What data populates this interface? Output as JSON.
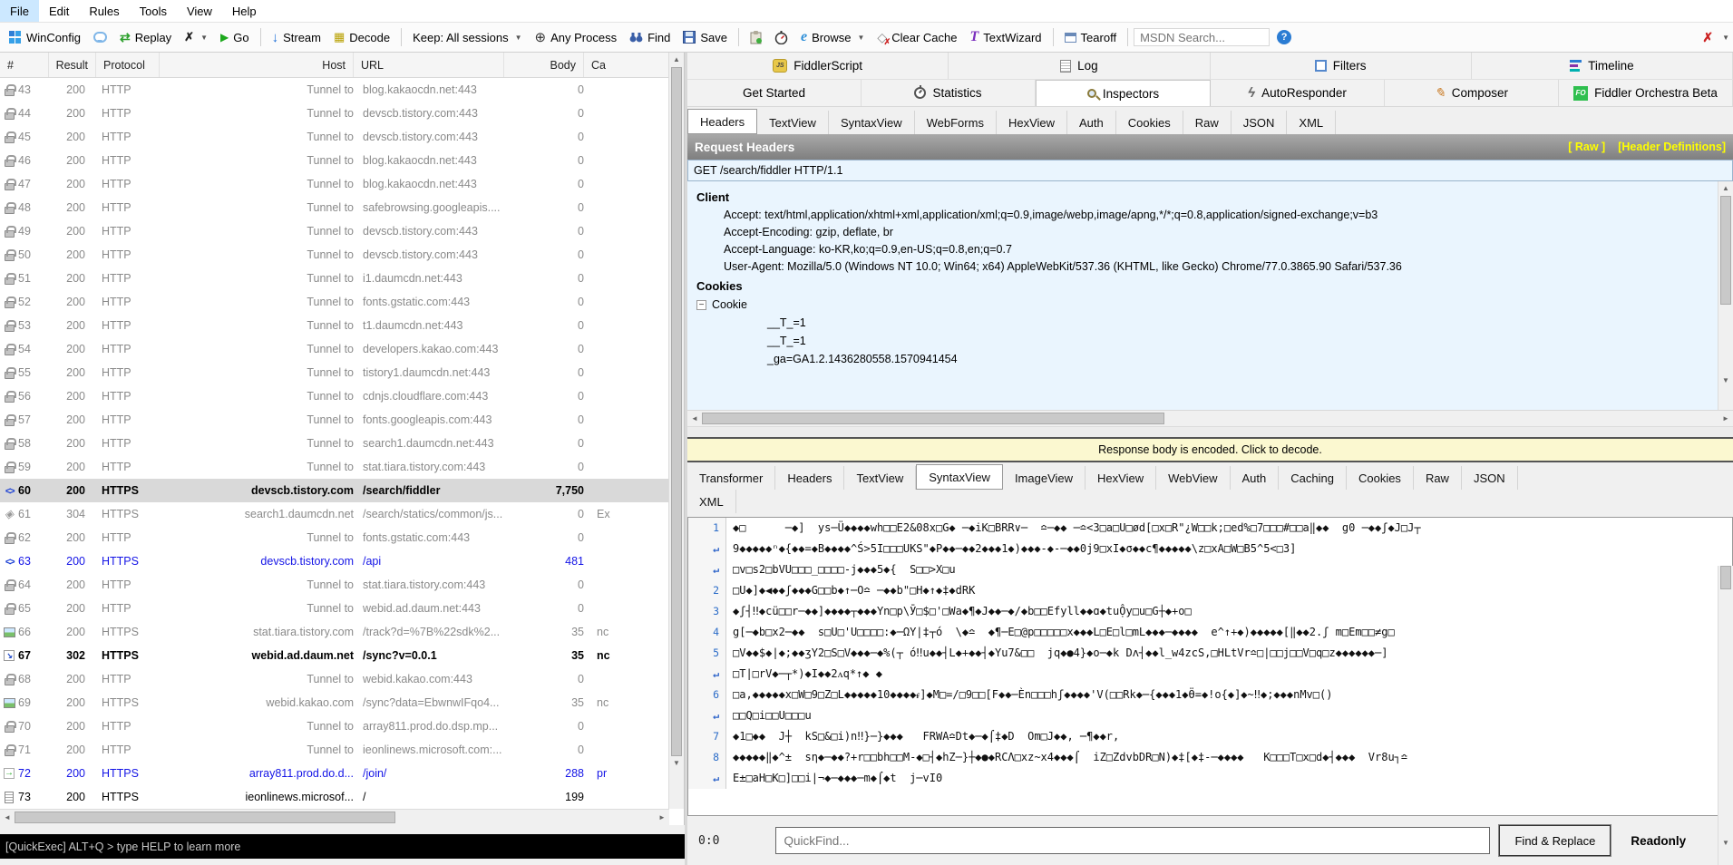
{
  "menu": {
    "items": [
      {
        "label": "File",
        "cls": "active"
      },
      {
        "label": "Edit",
        "cls": ""
      },
      {
        "label": "Rules",
        "cls": ""
      },
      {
        "label": "Tools",
        "cls": ""
      },
      {
        "label": "View",
        "cls": ""
      },
      {
        "label": "Help",
        "cls": ""
      }
    ]
  },
  "toolbar": {
    "winconfig": "WinConfig",
    "replay": "Replay",
    "go": "Go",
    "stream": "Stream",
    "decode": "Decode",
    "keep": "Keep: All sessions",
    "any_process": "Any Process",
    "find": "Find",
    "save": "Save",
    "browse": "Browse",
    "clear_cache": "Clear Cache",
    "textwizard": "TextWizard",
    "tearoff": "Tearoff",
    "msdn_placeholder": "MSDN Search..."
  },
  "sessions": {
    "columns": [
      "#",
      "Result",
      "Protocol",
      "Host",
      "URL",
      "Body",
      "Ca"
    ],
    "rows": [
      {
        "num": "43",
        "result": "200",
        "protocol": "HTTP",
        "host": "Tunnel to",
        "url": "blog.kakaocdn.net:443",
        "body": "0",
        "caching": "",
        "icon": "ic-lock",
        "style": "dim"
      },
      {
        "num": "44",
        "result": "200",
        "protocol": "HTTP",
        "host": "Tunnel to",
        "url": "devscb.tistory.com:443",
        "body": "0",
        "caching": "",
        "icon": "ic-lock",
        "style": "dim"
      },
      {
        "num": "45",
        "result": "200",
        "protocol": "HTTP",
        "host": "Tunnel to",
        "url": "devscb.tistory.com:443",
        "body": "0",
        "caching": "",
        "icon": "ic-lock",
        "style": "dim"
      },
      {
        "num": "46",
        "result": "200",
        "protocol": "HTTP",
        "host": "Tunnel to",
        "url": "blog.kakaocdn.net:443",
        "body": "0",
        "caching": "",
        "icon": "ic-lock",
        "style": "dim"
      },
      {
        "num": "47",
        "result": "200",
        "protocol": "HTTP",
        "host": "Tunnel to",
        "url": "blog.kakaocdn.net:443",
        "body": "0",
        "caching": "",
        "icon": "ic-lock",
        "style": "dim"
      },
      {
        "num": "48",
        "result": "200",
        "protocol": "HTTP",
        "host": "Tunnel to",
        "url": "safebrowsing.googleapis....",
        "body": "0",
        "caching": "",
        "icon": "ic-lock",
        "style": "dim"
      },
      {
        "num": "49",
        "result": "200",
        "protocol": "HTTP",
        "host": "Tunnel to",
        "url": "devscb.tistory.com:443",
        "body": "0",
        "caching": "",
        "icon": "ic-lock",
        "style": "dim"
      },
      {
        "num": "50",
        "result": "200",
        "protocol": "HTTP",
        "host": "Tunnel to",
        "url": "devscb.tistory.com:443",
        "body": "0",
        "caching": "",
        "icon": "ic-lock",
        "style": "dim"
      },
      {
        "num": "51",
        "result": "200",
        "protocol": "HTTP",
        "host": "Tunnel to",
        "url": "i1.daumcdn.net:443",
        "body": "0",
        "caching": "",
        "icon": "ic-lock",
        "style": "dim"
      },
      {
        "num": "52",
        "result": "200",
        "protocol": "HTTP",
        "host": "Tunnel to",
        "url": "fonts.gstatic.com:443",
        "body": "0",
        "caching": "",
        "icon": "ic-lock",
        "style": "dim"
      },
      {
        "num": "53",
        "result": "200",
        "protocol": "HTTP",
        "host": "Tunnel to",
        "url": "t1.daumcdn.net:443",
        "body": "0",
        "caching": "",
        "icon": "ic-lock",
        "style": "dim"
      },
      {
        "num": "54",
        "result": "200",
        "protocol": "HTTP",
        "host": "Tunnel to",
        "url": "developers.kakao.com:443",
        "body": "0",
        "caching": "",
        "icon": "ic-lock",
        "style": "dim"
      },
      {
        "num": "55",
        "result": "200",
        "protocol": "HTTP",
        "host": "Tunnel to",
        "url": "tistory1.daumcdn.net:443",
        "body": "0",
        "caching": "",
        "icon": "ic-lock",
        "style": "dim"
      },
      {
        "num": "56",
        "result": "200",
        "protocol": "HTTP",
        "host": "Tunnel to",
        "url": "cdnjs.cloudflare.com:443",
        "body": "0",
        "caching": "",
        "icon": "ic-lock",
        "style": "dim"
      },
      {
        "num": "57",
        "result": "200",
        "protocol": "HTTP",
        "host": "Tunnel to",
        "url": "fonts.googleapis.com:443",
        "body": "0",
        "caching": "",
        "icon": "ic-lock",
        "style": "dim"
      },
      {
        "num": "58",
        "result": "200",
        "protocol": "HTTP",
        "host": "Tunnel to",
        "url": "search1.daumcdn.net:443",
        "body": "0",
        "caching": "",
        "icon": "ic-lock",
        "style": "dim"
      },
      {
        "num": "59",
        "result": "200",
        "protocol": "HTTP",
        "host": "Tunnel to",
        "url": "stat.tiara.tistory.com:443",
        "body": "0",
        "caching": "",
        "icon": "ic-lock",
        "style": "dim"
      },
      {
        "num": "60",
        "result": "200",
        "protocol": "HTTPS",
        "host": "devscb.tistory.com",
        "url": "/search/fiddler",
        "body": "7,750",
        "caching": "",
        "icon": "ic-code",
        "style": "sel bold"
      },
      {
        "num": "61",
        "result": "304",
        "protocol": "HTTPS",
        "host": "search1.daumcdn.net",
        "url": "/search/statics/common/js...",
        "body": "0",
        "caching": "Ex",
        "icon": "ic-pkg",
        "style": "dim"
      },
      {
        "num": "62",
        "result": "200",
        "protocol": "HTTP",
        "host": "Tunnel to",
        "url": "fonts.gstatic.com:443",
        "body": "0",
        "caching": "",
        "icon": "ic-lock",
        "style": "dim"
      },
      {
        "num": "63",
        "result": "200",
        "protocol": "HTTPS",
        "host": "devscb.tistory.com",
        "url": "/api",
        "body": "481",
        "caching": "",
        "icon": "ic-code",
        "style": "blue"
      },
      {
        "num": "64",
        "result": "200",
        "protocol": "HTTP",
        "host": "Tunnel to",
        "url": "stat.tiara.tistory.com:443",
        "body": "0",
        "caching": "",
        "icon": "ic-lock",
        "style": "dim"
      },
      {
        "num": "65",
        "result": "200",
        "protocol": "HTTP",
        "host": "Tunnel to",
        "url": "webid.ad.daum.net:443",
        "body": "0",
        "caching": "",
        "icon": "ic-lock",
        "style": "dim"
      },
      {
        "num": "66",
        "result": "200",
        "protocol": "HTTPS",
        "host": "stat.tiara.tistory.com",
        "url": "/track?d=%7B%22sdk%2...",
        "body": "35",
        "caching": "nc",
        "icon": "ic-img",
        "style": "dim"
      },
      {
        "num": "67",
        "result": "302",
        "protocol": "HTTPS",
        "host": "webid.ad.daum.net",
        "url": "/sync?v=0.0.1",
        "body": "35",
        "caching": "nc",
        "icon": "ic-redir",
        "style": "dark bold"
      },
      {
        "num": "68",
        "result": "200",
        "protocol": "HTTP",
        "host": "Tunnel to",
        "url": "webid.kakao.com:443",
        "body": "0",
        "caching": "",
        "icon": "ic-lock",
        "style": "dim"
      },
      {
        "num": "69",
        "result": "200",
        "protocol": "HTTPS",
        "host": "webid.kakao.com",
        "url": "/sync?data=EbwnwIFqo4...",
        "body": "35",
        "caching": "nc",
        "icon": "ic-img",
        "style": "dim"
      },
      {
        "num": "70",
        "result": "200",
        "protocol": "HTTP",
        "host": "Tunnel to",
        "url": "array811.prod.do.dsp.mp...",
        "body": "0",
        "caching": "",
        "icon": "ic-lock",
        "style": "dim"
      },
      {
        "num": "71",
        "result": "200",
        "protocol": "HTTP",
        "host": "Tunnel to",
        "url": "ieonlinews.microsoft.com:...",
        "body": "0",
        "caching": "",
        "icon": "ic-lock",
        "style": "dim"
      },
      {
        "num": "72",
        "result": "200",
        "protocol": "HTTPS",
        "host": "array811.prod.do.d...",
        "url": "/join/",
        "body": "288",
        "caching": "pr",
        "icon": "ic-go",
        "style": "blue"
      },
      {
        "num": "73",
        "result": "200",
        "protocol": "HTTPS",
        "host": "ieonlinews.microsof...",
        "url": "/",
        "body": "199",
        "caching": "",
        "icon": "ic-doc",
        "style": "dark"
      }
    ]
  },
  "statusbar": {
    "text": "[QuickExec] ALT+Q > type HELP to learn more"
  },
  "right": {
    "main_tabs_row1": [
      {
        "label": "FiddlerScript",
        "icon": "ti-fiddlerscript",
        "cls": ""
      },
      {
        "label": "Log",
        "icon": "ti-log",
        "cls": ""
      },
      {
        "label": "Filters",
        "icon": "ti-filters",
        "cls": ""
      },
      {
        "label": "Timeline",
        "icon": "ti-timeline",
        "cls": ""
      }
    ],
    "main_tabs_row2": [
      {
        "label": "Get Started",
        "icon": "",
        "cls": ""
      },
      {
        "label": "Statistics",
        "icon": "ti-statistics",
        "cls": ""
      },
      {
        "label": "Inspectors",
        "icon": "ti-inspectors",
        "cls": "active"
      },
      {
        "label": "AutoResponder",
        "icon": "ti-autoresponder",
        "cls": ""
      },
      {
        "label": "Composer",
        "icon": "ti-composer",
        "cls": ""
      },
      {
        "label": "Fiddler Orchestra Beta",
        "icon": "ti-orchestra",
        "cls": ""
      }
    ],
    "request_tabs": [
      {
        "label": "Headers",
        "cls": "active"
      },
      {
        "label": "TextView",
        "cls": ""
      },
      {
        "label": "SyntaxView",
        "cls": ""
      },
      {
        "label": "WebForms",
        "cls": ""
      },
      {
        "label": "HexView",
        "cls": ""
      },
      {
        "label": "Auth",
        "cls": ""
      },
      {
        "label": "Cookies",
        "cls": ""
      },
      {
        "label": "Raw",
        "cls": ""
      },
      {
        "label": "JSON",
        "cls": ""
      },
      {
        "label": "XML",
        "cls": ""
      }
    ],
    "request_headers": {
      "title": "Request Headers",
      "raw_link": "[ Raw ]",
      "defs_link": "[Header Definitions]",
      "request_line": "GET /search/fiddler HTTP/1.1",
      "client_section": "Client",
      "client_lines": [
        "Accept: text/html,application/xhtml+xml,application/xml;q=0.9,image/webp,image/apng,*/*;q=0.8,application/signed-exchange;v=b3",
        "Accept-Encoding: gzip, deflate, br",
        "Accept-Language: ko-KR,ko;q=0.9,en-US;q=0.8,en;q=0.7",
        "User-Agent: Mozilla/5.0 (Windows NT 10.0; Win64; x64) AppleWebKit/537.36 (KHTML, like Gecko) Chrome/77.0.3865.90 Safari/537.36"
      ],
      "cookies_section": "Cookies",
      "cookie_node": "Cookie",
      "cookie_values": [
        "__T_=1",
        "__T_=1",
        "_ga=GA1.2.1436280558.1570941454"
      ]
    },
    "encoded_banner": "Response body is encoded. Click to decode.",
    "response_tabs_row1": [
      {
        "label": "Transformer",
        "cls": ""
      },
      {
        "label": "Headers",
        "cls": ""
      },
      {
        "label": "TextView",
        "cls": ""
      },
      {
        "label": "SyntaxView",
        "cls": "active"
      },
      {
        "label": "ImageView",
        "cls": ""
      },
      {
        "label": "HexView",
        "cls": ""
      },
      {
        "label": "WebView",
        "cls": ""
      },
      {
        "label": "Auth",
        "cls": ""
      },
      {
        "label": "Caching",
        "cls": ""
      },
      {
        "label": "Cookies",
        "cls": ""
      },
      {
        "label": "Raw",
        "cls": ""
      },
      {
        "label": "JSON",
        "cls": ""
      }
    ],
    "response_tabs_row2": [
      {
        "label": "XML",
        "cls": ""
      }
    ],
    "editor": {
      "rows": [
        {
          "num": "1",
          "cls": "",
          "text": "◆□      ─◆]  ys─Ü◆◆◆◆wh□□E2&08x□G◆ ─◆iK□BRR∨─  ≏─◆◆ ─≏<3□a□U□ød[□x□R\"¿W□□k;□ed%□7□□□#□□a‖◆◆  g0 ─◆◆ʃ◆J□J┬"
        },
        {
          "num": "",
          "cls": "wrap",
          "text": "9◆◆◆◆◆ⁿ◆{◆◆=◆B◆◆◆◆^Ś>5I□□□UKS\"◆P◆◆─◆◆2◆◆◆1◆)◆◆◆-◆-─◆◆0j9□xI◆σ◆◆c¶◆◆◆◆◆\\z□xA□W□B5^5<□3]"
        },
        {
          "num": "",
          "cls": "wrap",
          "text": "□v□s2□bVU□□□_□□□□-j◆◆◆5◆{  S□□>X□u"
        },
        {
          "num": "2",
          "cls": "",
          "text": "□U◆]◆◀◆◆ʃ◆◆◆G□□b◆↑─O≏ ─◆◆b\"□H◆↑◆‡◆dRK"
        },
        {
          "num": "3",
          "cls": "",
          "text": "◆ʃ┤‼◆cü□□r─◆◆]◆◆◆◆┬◆◆◆Yn□p\\Ӯ□$□'□Wa◆¶◆J◆◆─◆/◆b□□Efyll◆◆ɑ◆tuỘy□u□G┼◆+o□"
        },
        {
          "num": "4",
          "cls": "",
          "text": "g[─◆b□x2─◆◆  s□U□'U□□□□:◆─ΩY|‡┬ó  \\◆≏  ◆¶─E□@p□□□□□x◆◆◆L□E□l□mL◆◆◆─◆◆◆◆  e^↑+◆)◆◆◆◆◆[‖◆◆2.ʃ m□Em□□≠g□"
        },
        {
          "num": "5",
          "cls": "",
          "text": "□V◆◆$◆|◆;◆◆ʒY2□S□V◆◆◆─◆%(┬ ó‼u◆◆┤L◆+◆◆┤◆Yu7&□□  jq◆●4}◆o─◆k Dʌ┤◆◆l_w4zcS,□HLtVr≏□|□□j□□V□q□z◆◆◆◆◆◆─]"
        },
        {
          "num": "",
          "cls": "wrap",
          "text": "□T|□rV◆─┬*)◆I◆◆2ᴧq*↑◆ ◆"
        },
        {
          "num": "6",
          "cls": "",
          "text": "□a,◆◆◆◆◆x□W□9□Z□L◆◆◆◆◆10◆◆◆◆ᵳ]◆M□=/□9□□[F◆◆─Èn□□□hʃ◆◆◆◆'V(□□Rk◆─{◆◆◆1◆Ӫ=◆!o{◆]◆~‼◆;◆◆◆nMv□()"
        },
        {
          "num": "",
          "cls": "wrap",
          "text": "□□Q□i□□U□□□u"
        },
        {
          "num": "7",
          "cls": "",
          "text": "◆1□◆◆  J┼  kS□&□i)n‼}─}◆◆◆   FRWA≏Dt◆─◆⌠‡◆D  Om□J◆◆, ─¶◆◆r,"
        },
        {
          "num": "8",
          "cls": "",
          "text": "◆◆◆◆◆‖◆^±  sη◆─◆◆?+r□□bh□□M-◆□┤◆hZ─}┼◆●◆RCΛ□xz~x4◆◆◆⌠  iZ□ZdvbDR□N)◆‡[◆‡-─◆◆◆◆   K□□□T□x□d◆┤◆◆◆  Vr8u┐≏"
        },
        {
          "num": "",
          "cls": "wrap",
          "text": "E±□aH□K□]□□i|¬◆─◆◆◆─m◆⌠◆t  j─vI0"
        }
      ]
    },
    "find_bar": {
      "position": "0:0",
      "placeholder": "QuickFind...",
      "button": "Find & Replace",
      "mode": "Readonly"
    }
  },
  "colors": {
    "selected_row_bg": "#d9d9d9",
    "session_link_blue": "#1414e6",
    "header_bar_links_yellow": "#ffff00",
    "encoded_banner_bg": "#fbf8d0",
    "statusbar_bg": "#000000",
    "orchestra_green": "#2fbf4f",
    "headers_pane_bg": "#eaf5fe"
  }
}
